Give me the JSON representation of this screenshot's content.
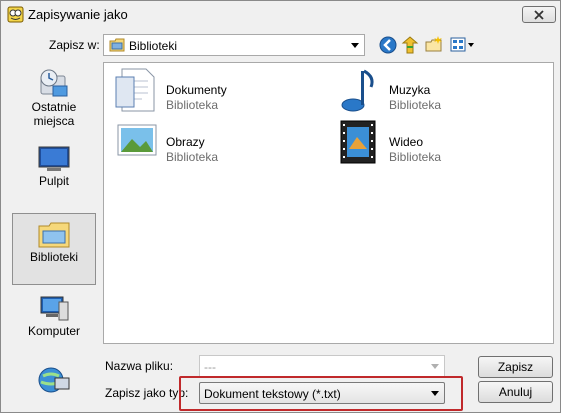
{
  "window": {
    "title": "Zapisywanie jako"
  },
  "location": {
    "label": "Zapisz w:",
    "value": "Biblioteki"
  },
  "places": [
    {
      "label": "Ostatnie miejsca",
      "icon": "recent-places-icon"
    },
    {
      "label": "Pulpit",
      "icon": "desktop-icon"
    },
    {
      "label": "Biblioteki",
      "icon": "libraries-icon",
      "selected": true
    },
    {
      "label": "Komputer",
      "icon": "computer-icon"
    },
    {
      "label": "",
      "icon": "network-icon"
    }
  ],
  "files": [
    {
      "name": "Dokumenty",
      "type": "Biblioteka",
      "icon": "documents-library-icon"
    },
    {
      "name": "Muzyka",
      "type": "Biblioteka",
      "icon": "music-library-icon"
    },
    {
      "name": "Obrazy",
      "type": "Biblioteka",
      "icon": "pictures-library-icon"
    },
    {
      "name": "Wideo",
      "type": "Biblioteka",
      "icon": "videos-library-icon"
    }
  ],
  "filename": {
    "label": "Nazwa pliku:",
    "value": "---"
  },
  "filetype": {
    "label": "Zapisz jako typ:",
    "value": "Dokument tekstowy (*.txt)"
  },
  "buttons": {
    "save": "Zapisz",
    "cancel": "Anuluj"
  },
  "colors": {
    "highlight": "#c0292b",
    "selection": "#e2e2e2"
  }
}
